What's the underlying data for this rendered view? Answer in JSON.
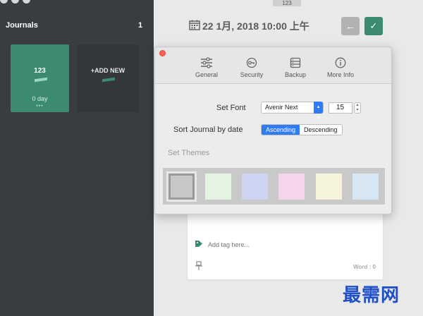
{
  "sidebar": {
    "title": "Journals",
    "count": "1",
    "journal": {
      "name": "123",
      "days": "0 day",
      "dots": "•••"
    },
    "add_label": "+ADD NEW"
  },
  "top_pill": "123",
  "header": {
    "date": "22 1月, 2018 10:00 上午",
    "calendar_icon": "calendar-icon",
    "back_icon": "arrow-left-icon",
    "confirm_icon": "checkmark-icon"
  },
  "editor": {
    "tag_placeholder": "Add tag here...",
    "word_count": "Word : 0"
  },
  "dialog": {
    "tabs": [
      {
        "label": "General",
        "icon": "sliders-icon"
      },
      {
        "label": "Security",
        "icon": "key-icon"
      },
      {
        "label": "Backup",
        "icon": "database-icon"
      },
      {
        "label": "More Info",
        "icon": "info-icon"
      }
    ],
    "set_font_label": "Set Font",
    "font_value": "Avenir Next",
    "font_size": "15",
    "sort_label": "Sort Journal by date",
    "sort_options": [
      "Ascending",
      "Descending"
    ],
    "sort_selected": "Ascending",
    "themes_label": "Set Themes",
    "themes": [
      "#c7c7c7",
      "#e3f5e0",
      "#cdd4f1",
      "#f5d5ec",
      "#f6f4dc",
      "#d7e6f3"
    ]
  },
  "watermark": "最需网",
  "colors": {
    "accent": "#3c8a6f",
    "sidebar": "#3a3d40",
    "select_blue": "#2f7cf6"
  }
}
